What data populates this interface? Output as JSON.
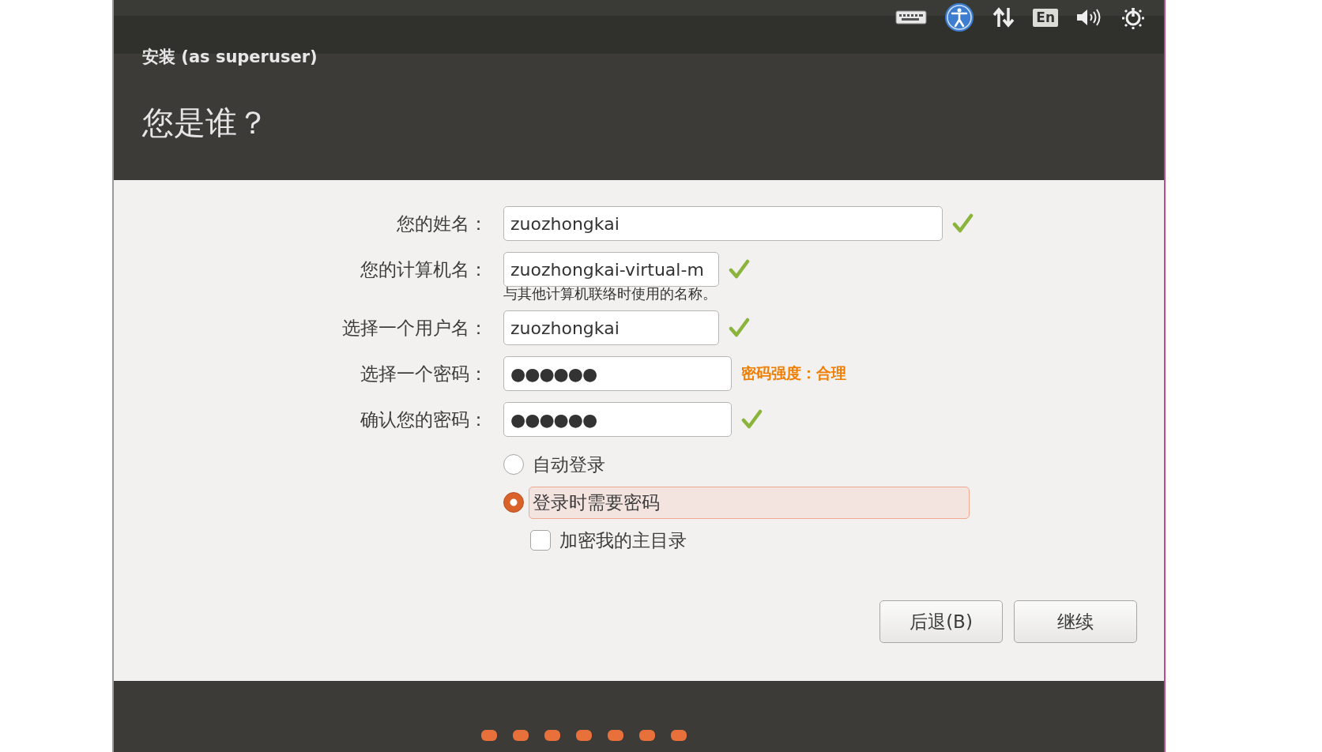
{
  "top_panel": {
    "language": "En"
  },
  "header": {
    "window_title": "安装 (as superuser)",
    "heading": "您是谁？"
  },
  "fields": [
    {
      "label": "您的姓名：",
      "value": "zuozhongkai",
      "kind": "text",
      "valid": true
    },
    {
      "label": "您的计算机名：",
      "value": "zuozhongkai-virtual-m",
      "kind": "text",
      "valid": true,
      "hint": "与其他计算机联络时使用的名称。"
    },
    {
      "label": "选择一个用户名：",
      "value": "zuozhongkai",
      "kind": "text",
      "valid": true
    },
    {
      "label": "选择一个密码：",
      "value": "●●●●●●",
      "kind": "password",
      "valid": false,
      "strength": "密码强度：合理"
    },
    {
      "label": "确认您的密码：",
      "value": "●●●●●●",
      "kind": "password",
      "valid": true
    }
  ],
  "options": [
    {
      "label": "自动登录",
      "kind": "radio",
      "selected": false
    },
    {
      "label": "登录时需要密码",
      "kind": "radio",
      "selected": true
    },
    {
      "label": "加密我的主目录",
      "kind": "checkbox",
      "checked": false
    }
  ],
  "buttons": [
    {
      "label": "后退(B)"
    },
    {
      "label": "继续"
    }
  ],
  "progress": [
    {
      "done": true
    },
    {
      "done": true
    },
    {
      "done": true
    },
    {
      "done": true
    },
    {
      "done": true
    },
    {
      "done": true
    },
    {
      "done": true
    }
  ]
}
